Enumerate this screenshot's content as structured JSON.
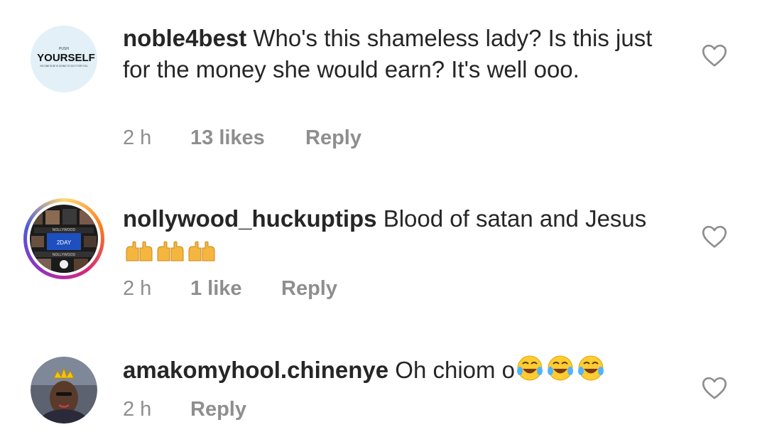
{
  "comments": [
    {
      "username": "noble4best",
      "text": "Who's this shameless lady? Is this just for the money she would earn? It's well ooo.",
      "time": "2 h",
      "likes": "13 likes",
      "reply": "Reply",
      "avatar": {
        "top": "PUSH",
        "main": "YOURSELF",
        "sub": "NO ONE ELSE IS GOING TO DO IT FOR YOU"
      }
    },
    {
      "username": "nollywood_huckuptips",
      "text": "Blood of satan and Jesus",
      "emoji": "raised-hands-icon",
      "time": "2 h",
      "likes": "1 like",
      "reply": "Reply",
      "avatar": {
        "label1": "NOLLYWOOD",
        "label2": "2DAY",
        "label3": "NOLLYWOOD"
      }
    },
    {
      "username": "amakomyhool.chinenye",
      "text": "Oh chiom o",
      "emoji": "tears-of-joy-icon",
      "time": "2 h",
      "reply": "Reply"
    }
  ],
  "colors": {
    "text": "#262626",
    "meta": "#8e8e8e",
    "story_ring": "#d62976",
    "heart_stroke": "#8e8e8e"
  }
}
